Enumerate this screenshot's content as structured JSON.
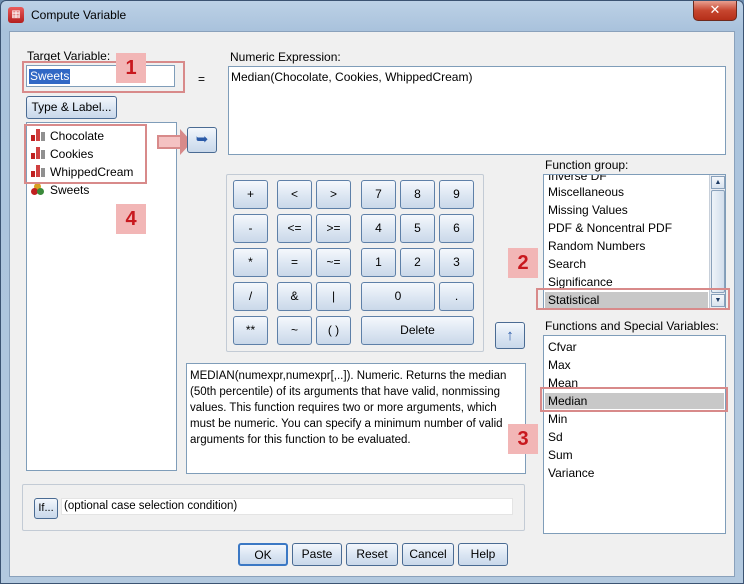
{
  "window": {
    "title": "Compute Variable",
    "close_glyph": "✕",
    "app_icon": "spss-compute-icon"
  },
  "target": {
    "label": "Target Variable:",
    "value": "Sweets",
    "equals": "=",
    "type_label_button": "Type & Label..."
  },
  "expression": {
    "label": "Numeric Expression:",
    "value": "Median(Chocolate, Cookies, WhippedCream)"
  },
  "variables": [
    {
      "name": "Chocolate",
      "icon": "scale-variable-icon"
    },
    {
      "name": "Cookies",
      "icon": "scale-variable-icon"
    },
    {
      "name": "WhippedCream",
      "icon": "scale-variable-icon"
    },
    {
      "name": "Sweets",
      "icon": "nominal-variable-icon"
    }
  ],
  "move_button_glyph": "➥",
  "insert_button_glyph": "↑",
  "calculator": {
    "row1": [
      "+",
      "<",
      ">",
      "7",
      "8",
      "9"
    ],
    "row2": [
      "-",
      "<=",
      ">=",
      "4",
      "5",
      "6"
    ],
    "row3": [
      "*",
      "=",
      "~=",
      "1",
      "2",
      "3"
    ],
    "row4": [
      "/",
      "&",
      "|",
      "0",
      "."
    ],
    "row5": [
      "**",
      "~",
      "( )",
      "Delete"
    ]
  },
  "description": "MEDIAN(numexpr,numexpr[,..]). Numeric. Returns the median (50th percentile) of its arguments that have valid, nonmissing values. This function requires two or more arguments, which must be numeric. You can specify a minimum number of valid arguments for this function to be evaluated.",
  "function_group": {
    "label": "Function group:",
    "partial_item": "Inverse DF",
    "items": [
      "Miscellaneous",
      "Missing Values",
      "PDF & Noncentral PDF",
      "Random Numbers",
      "Search",
      "Significance",
      "Statistical"
    ],
    "selected": "Statistical"
  },
  "functions": {
    "label": "Functions and Special Variables:",
    "items": [
      "Cfvar",
      "Max",
      "Mean",
      "Median",
      "Min",
      "Sd",
      "Sum",
      "Variance"
    ],
    "selected": "Median"
  },
  "if_row": {
    "button": "If...",
    "text": "(optional case selection condition)"
  },
  "footer": {
    "ok": "OK",
    "paste": "Paste",
    "reset": "Reset",
    "cancel": "Cancel",
    "help": "Help"
  },
  "annotations": {
    "b1": "1",
    "b2": "2",
    "b3": "3",
    "b4": "4"
  },
  "colors": {
    "highlight": "#d88a8a",
    "badge_bg": "#f2b6b6",
    "badge_text": "#c8181e",
    "selection": "#c8c8c8"
  }
}
